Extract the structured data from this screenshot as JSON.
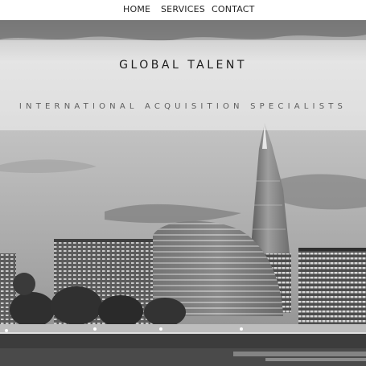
{
  "nav": {
    "items": [
      {
        "label": "HOME"
      },
      {
        "label": "SERVICES"
      },
      {
        "label": "CONTACT"
      }
    ]
  },
  "hero": {
    "title": "GLOBAL TALENT",
    "tagline": "INTERNATIONAL ACQUISITION SPECIALISTS"
  },
  "colors": {
    "nav_background": "#ffffff",
    "nav_text": "#222222",
    "title_text": "#1c1c1c",
    "tagline_text": "#5e5e5e"
  }
}
